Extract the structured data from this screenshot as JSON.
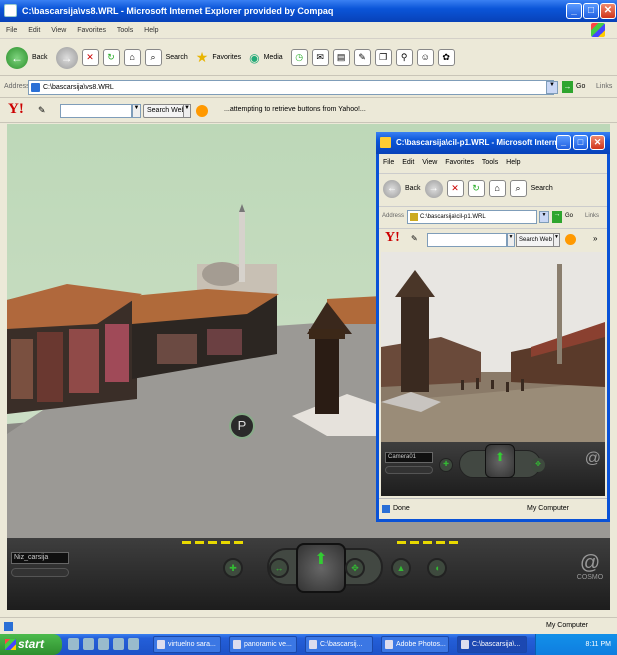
{
  "window": {
    "title": "C:\\bascarsija\\vs8.WRL - Microsoft Internet Explorer provided by Compaq",
    "menu": [
      "File",
      "Edit",
      "View",
      "Favorites",
      "Tools",
      "Help"
    ],
    "toolbar": {
      "back": "Back",
      "search": "Search",
      "favorites": "Favorites",
      "media": "Media"
    },
    "address_label": "Address",
    "address_value": "C:\\bascarsija\\vs8.WRL",
    "go_label": "Go",
    "links_label": "Links"
  },
  "yahoo": {
    "search_button": "Search Web",
    "message": "...attempting to retrieve buttons from Yahoo!..."
  },
  "scene": {
    "sign_letter": "P"
  },
  "nav": {
    "camera": "Niz_carsija",
    "brand": "COSMO"
  },
  "status": {
    "zone": "My Computer"
  },
  "sub": {
    "title": "C:\\bascarsija\\cil-p1.WRL - Microsoft Interne...",
    "menu": [
      "File",
      "Edit",
      "View",
      "Favorites",
      "Tools",
      "Help"
    ],
    "back": "Back",
    "search": "Search",
    "address_label": "Address",
    "address_value": "C:\\bascarsija\\cil-p1.WRL",
    "go_label": "Go",
    "links_label": "Links",
    "yahoo_button": "Search Web",
    "camera": "Camera01",
    "status_left": "Done",
    "status_zone": "My Computer"
  },
  "taskbar": {
    "start": "start",
    "tasks": [
      "virtuelno sara...",
      "panoramic ve...",
      "C:\\bascarsij...",
      "Adobe Photos...",
      "C:\\bascarsija\\..."
    ],
    "clock": "8:11 PM"
  },
  "colors": {
    "xp_blue": "#0a55d8",
    "start_green": "#2e8e2e",
    "nav_yellow": "#e8d900"
  }
}
